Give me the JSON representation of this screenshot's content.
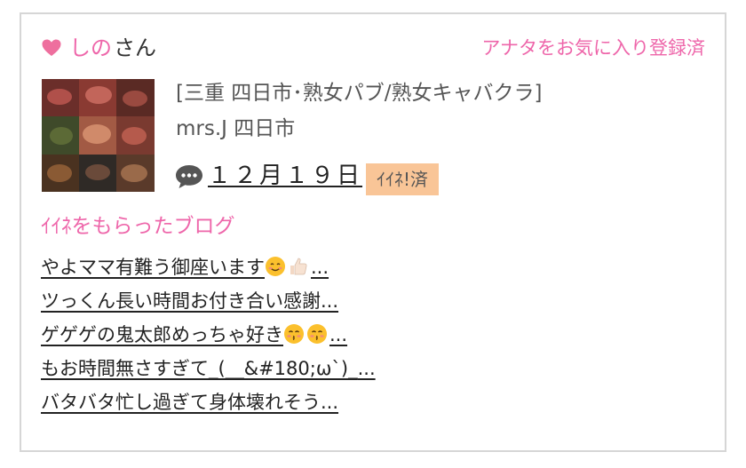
{
  "user": {
    "name": "しの",
    "suffix": "さん",
    "favorite_status": "アナタをお気に入り登録済"
  },
  "shop": {
    "category": "[三重 四日市･熟女パブ/熟女キャバクラ]",
    "name": "mrs.J 四日市"
  },
  "activity": {
    "date": "１２月１９日",
    "badge": "ｲｲﾈ!済"
  },
  "blog": {
    "heading": "ｲｲﾈをもらったブログ",
    "items": [
      {
        "text": "やよママ有難う御座います",
        "ellipsis": "..."
      },
      {
        "text": "ツっくん長い時間お付き合い感謝",
        "ellipsis": "..."
      },
      {
        "text": "ゲゲゲの鬼太郎めっちゃ好き",
        "ellipsis": "..."
      },
      {
        "text": "もお時間無さすぎて_(__&#180;ω`)_",
        "ellipsis": "..."
      },
      {
        "text": "バタバタ忙し過ぎて身体壊れそう",
        "ellipsis": "..."
      }
    ]
  },
  "icons": {
    "heart": "heart-icon",
    "comment": "speech-bubble-icon",
    "smile": "smiling-face-emoji",
    "thumbs_up": "thumbs-up-emoji",
    "kiss": "kissing-face-emoji"
  },
  "colors": {
    "accent_pink": "#ee66aa",
    "badge_bg": "#f9c597",
    "border": "#d6d6d6"
  }
}
